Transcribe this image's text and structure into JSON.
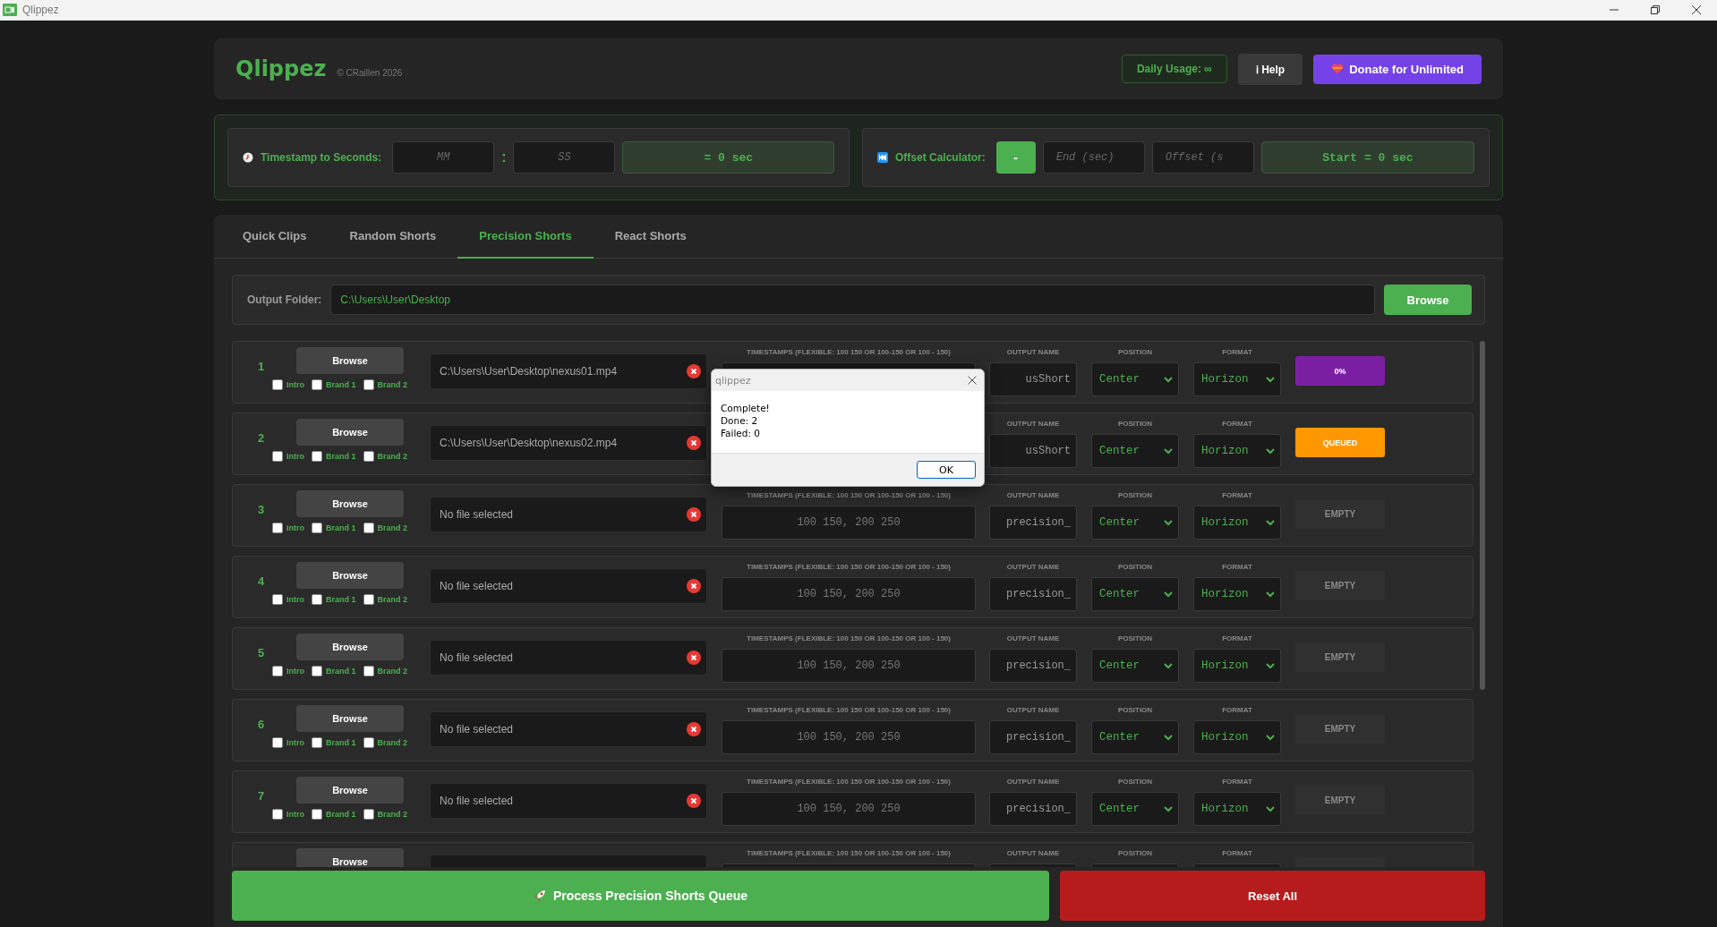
{
  "window": {
    "title": "Qlippez"
  },
  "header": {
    "app_name": "Qlippez",
    "copyright": "© CRaillen 2026",
    "usage": "Daily Usage: ∞",
    "help": "ℹ Help",
    "donate": "Donate for Unlimited"
  },
  "timestamp_tool": {
    "label": "Timestamp to Seconds:",
    "minutes_placeholder": "MM",
    "separator": ":",
    "seconds_placeholder": "SS",
    "result": "= 0 sec"
  },
  "offset_tool": {
    "label": "Offset Calculator:",
    "operator": "-",
    "end_placeholder": "End (sec)",
    "offset_placeholder": "Offset (s",
    "result": "Start = 0 sec"
  },
  "tabs": [
    {
      "label": "Quick Clips",
      "selected": false
    },
    {
      "label": "Random Shorts",
      "selected": false
    },
    {
      "label": "Precision Shorts",
      "selected": true
    },
    {
      "label": "React Shorts",
      "selected": false
    }
  ],
  "output_folder": {
    "label": "Output Folder:",
    "value": "C:\\Users\\User\\Desktop",
    "button": "Browse"
  },
  "rows": [
    {
      "number": "1",
      "browse": "Browse",
      "options": [
        {
          "label": "Intro",
          "checked": false
        },
        {
          "label": "Brand 1",
          "checked": false
        },
        {
          "label": "Brand 2",
          "checked": false
        }
      ],
      "file": "C:\\Users\\User\\Desktop\\nexus01.mp4",
      "timestamps_label": "TIMESTAMPS (FLEXIBLE: 100 150 OR 100-150 OR 100 - 150)",
      "output_label": "OUTPUT NAME",
      "output_name": "usShort",
      "position_label": "POSITION",
      "position": "Center",
      "format_label": "FORMAT",
      "format": "Horizon",
      "status": {
        "kind": "progress",
        "text": "0%"
      }
    },
    {
      "number": "2",
      "browse": "Browse",
      "options": [
        {
          "label": "Intro",
          "checked": false
        },
        {
          "label": "Brand 1",
          "checked": false
        },
        {
          "label": "Brand 2",
          "checked": false
        }
      ],
      "file": "C:\\Users\\User\\Desktop\\nexus02.mp4",
      "output_label": "OUTPUT NAME",
      "output_name": "usShort",
      "position_label": "POSITION",
      "position": "Center",
      "format_label": "FORMAT",
      "format": "Horizon",
      "status": {
        "kind": "queued",
        "text": "QUEUED"
      }
    },
    {
      "number": "3",
      "browse": "Browse",
      "options": [
        {
          "label": "Intro",
          "checked": false
        },
        {
          "label": "Brand 1",
          "checked": false
        },
        {
          "label": "Brand 2",
          "checked": false
        }
      ],
      "file": "No file selected",
      "timestamps_label": "TIMESTAMPS (FLEXIBLE: 100 150 OR 100-150 OR 100 - 150)",
      "timestamps_placeholder": "100 150, 200 250",
      "output_label": "OUTPUT NAME",
      "output_name": "precision_",
      "position_label": "POSITION",
      "position": "Center",
      "format_label": "FORMAT",
      "format": "Horizon",
      "status": {
        "kind": "empty",
        "text": "EMPTY"
      }
    },
    {
      "number": "4",
      "browse": "Browse",
      "options": [
        {
          "label": "Intro",
          "checked": false
        },
        {
          "label": "Brand 1",
          "checked": false
        },
        {
          "label": "Brand 2",
          "checked": false
        }
      ],
      "file": "No file selected",
      "timestamps_label": "TIMESTAMPS (FLEXIBLE: 100 150 OR 100-150 OR 100 - 150)",
      "timestamps_placeholder": "100 150, 200 250",
      "output_label": "OUTPUT NAME",
      "output_name": "precision_",
      "position_label": "POSITION",
      "position": "Center",
      "format_label": "FORMAT",
      "format": "Horizon",
      "status": {
        "kind": "empty",
        "text": "EMPTY"
      }
    },
    {
      "number": "5",
      "browse": "Browse",
      "options": [
        {
          "label": "Intro",
          "checked": false
        },
        {
          "label": "Brand 1",
          "checked": false
        },
        {
          "label": "Brand 2",
          "checked": false
        }
      ],
      "file": "No file selected",
      "timestamps_label": "TIMESTAMPS (FLEXIBLE: 100 150 OR 100-150 OR 100 - 150)",
      "timestamps_placeholder": "100 150, 200 250",
      "output_label": "OUTPUT NAME",
      "output_name": "precision_",
      "position_label": "POSITION",
      "position": "Center",
      "format_label": "FORMAT",
      "format": "Horizon",
      "status": {
        "kind": "empty",
        "text": "EMPTY"
      }
    },
    {
      "number": "6",
      "browse": "Browse",
      "options": [
        {
          "label": "Intro",
          "checked": false
        },
        {
          "label": "Brand 1",
          "checked": false
        },
        {
          "label": "Brand 2",
          "checked": false
        }
      ],
      "file": "No file selected",
      "timestamps_label": "TIMESTAMPS (FLEXIBLE: 100 150 OR 100-150 OR 100 - 150)",
      "timestamps_placeholder": "100 150, 200 250",
      "output_label": "OUTPUT NAME",
      "output_name": "precision_",
      "position_label": "POSITION",
      "position": "Center",
      "format_label": "FORMAT",
      "format": "Horizon",
      "status": {
        "kind": "empty",
        "text": "EMPTY"
      }
    },
    {
      "number": "7",
      "browse": "Browse",
      "options": [
        {
          "label": "Intro",
          "checked": false
        },
        {
          "label": "Brand 1",
          "checked": false
        },
        {
          "label": "Brand 2",
          "checked": false
        }
      ],
      "file": "No file selected",
      "timestamps_label": "TIMESTAMPS (FLEXIBLE: 100 150 OR 100-150 OR 100 - 150)",
      "timestamps_placeholder": "100 150, 200 250",
      "output_label": "OUTPUT NAME",
      "output_name": "precision_",
      "position_label": "POSITION",
      "position": "Center",
      "format_label": "FORMAT",
      "format": "Horizon",
      "status": {
        "kind": "empty",
        "text": "EMPTY"
      }
    },
    {
      "browse": "Browse",
      "timestamps_label": "TIMESTAMPS (FLEXIBLE: 100 150 OR 100-150 OR 100 - 150)",
      "output_label": "OUTPUT NAME",
      "position_label": "POSITION",
      "format_label": "FORMAT",
      "status": {
        "kind": "empty"
      }
    }
  ],
  "dialog": {
    "title": "qlippez",
    "lines": [
      "Complete!",
      "Done: 2",
      "Failed: 0"
    ],
    "button": "OK"
  },
  "actions": {
    "process": "Process Precision Shorts Queue",
    "reset": "Reset All"
  }
}
